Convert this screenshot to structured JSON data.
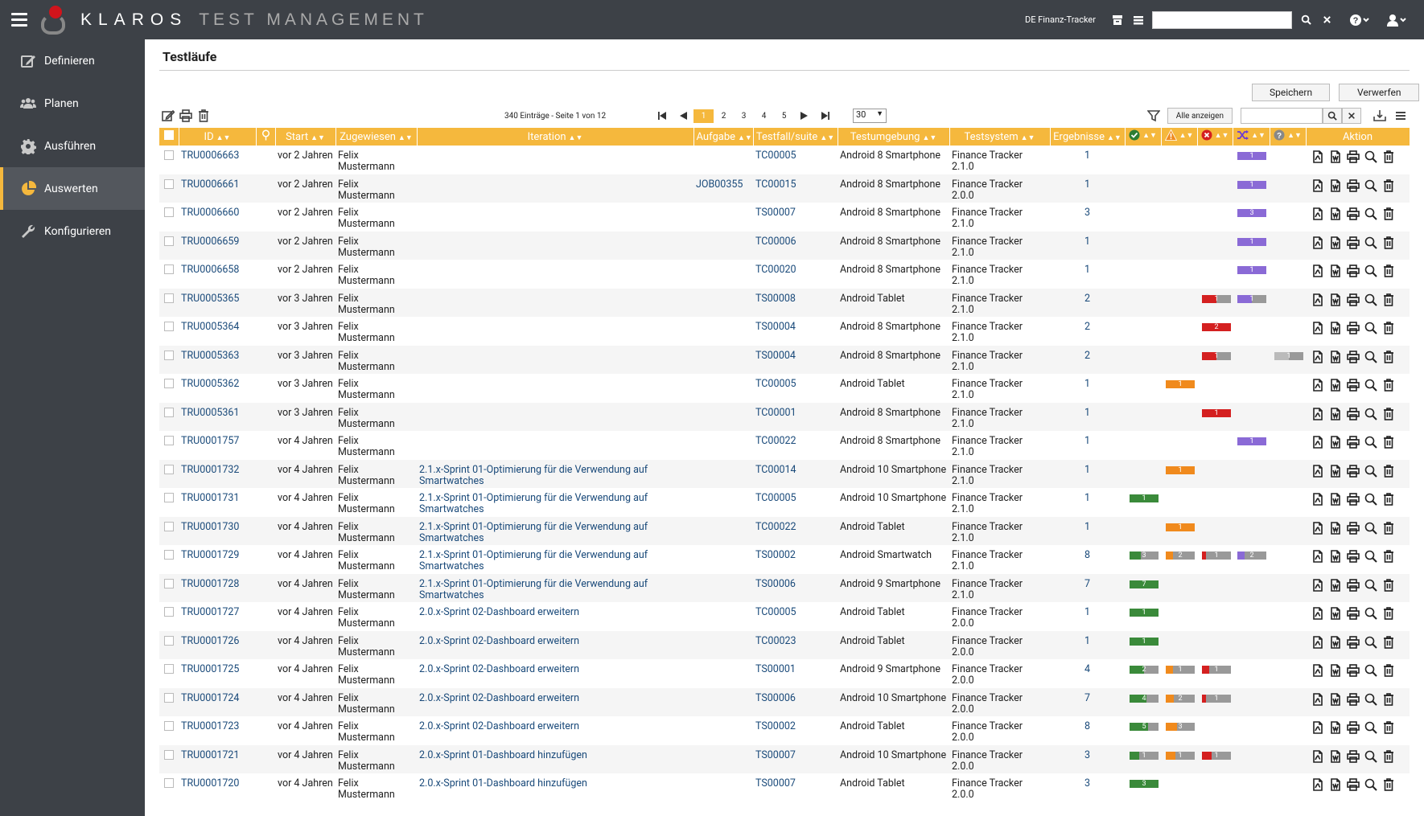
{
  "app": {
    "brand_main": "KLAROS",
    "brand_sub": "TEST MANAGEMENT",
    "project": "DE Finanz-Tracker"
  },
  "sidebar": {
    "items": [
      {
        "label": "Definieren",
        "icon": "edit-icon",
        "active": false
      },
      {
        "label": "Planen",
        "icon": "users-icon",
        "active": false
      },
      {
        "label": "Ausführen",
        "icon": "gear-icon",
        "active": false
      },
      {
        "label": "Auswerten",
        "icon": "pie-chart-icon",
        "active": true
      },
      {
        "label": "Konfigurieren",
        "icon": "wrench-icon",
        "active": false
      }
    ]
  },
  "page": {
    "title": "Testläufe",
    "save_label": "Speichern",
    "discard_label": "Verwerfen"
  },
  "pager": {
    "info": "340 Einträge - Seite 1 von 12",
    "pages": [
      "1",
      "2",
      "3",
      "4",
      "5"
    ],
    "current": "1",
    "per_page": "30",
    "show_all_label": "Alle anzeigen"
  },
  "table": {
    "headers": {
      "id": "ID",
      "start": "Start",
      "assigned": "Zugewiesen",
      "iteration": "Iteration",
      "job": "Aufgabe",
      "testcase": "Testfall/suite",
      "env": "Testumgebung",
      "sut": "Testsystem",
      "results": "Ergebnisse",
      "action": "Aktion"
    },
    "rows": [
      {
        "id": "TRU0006663",
        "start": "vor 2 Jahren",
        "assigned": "Felix Mustermann",
        "iteration": "",
        "job": "",
        "tc": "TC00005",
        "env": "Android 8 Smartphone",
        "sut1": "Finance Tracker",
        "sut2": "2.1.0",
        "results": "1",
        "pass": "",
        "warn": "",
        "fail": "",
        "skip": "1",
        "unk": ""
      },
      {
        "id": "TRU0006661",
        "start": "vor 2 Jahren",
        "assigned": "Felix Mustermann",
        "iteration": "",
        "job": "JOB00355",
        "tc": "TC00015",
        "env": "Android 8 Smartphone",
        "sut1": "Finance Tracker",
        "sut2": "2.0.0",
        "results": "1",
        "pass": "",
        "warn": "",
        "fail": "",
        "skip": "1",
        "unk": ""
      },
      {
        "id": "TRU0006660",
        "start": "vor 2 Jahren",
        "assigned": "Felix Mustermann",
        "iteration": "",
        "job": "",
        "tc": "TS00007",
        "env": "Android 8 Smartphone",
        "sut1": "Finance Tracker",
        "sut2": "2.1.0",
        "results": "3",
        "pass": "",
        "warn": "",
        "fail": "",
        "skip": "3",
        "unk": ""
      },
      {
        "id": "TRU0006659",
        "start": "vor 2 Jahren",
        "assigned": "Felix Mustermann",
        "iteration": "",
        "job": "",
        "tc": "TC00006",
        "env": "Android 8 Smartphone",
        "sut1": "Finance Tracker",
        "sut2": "2.1.0",
        "results": "1",
        "pass": "",
        "warn": "",
        "fail": "",
        "skip": "1",
        "unk": ""
      },
      {
        "id": "TRU0006658",
        "start": "vor 2 Jahren",
        "assigned": "Felix Mustermann",
        "iteration": "",
        "job": "",
        "tc": "TC00020",
        "env": "Android 8 Smartphone",
        "sut1": "Finance Tracker",
        "sut2": "2.1.0",
        "results": "1",
        "pass": "",
        "warn": "",
        "fail": "",
        "skip": "1",
        "unk": ""
      },
      {
        "id": "TRU0005365",
        "start": "vor 3 Jahren",
        "assigned": "Felix Mustermann",
        "iteration": "",
        "job": "",
        "tc": "TS00008",
        "env": "Android Tablet",
        "sut1": "Finance Tracker",
        "sut2": "2.1.0",
        "results": "2",
        "pass": "",
        "warn": "",
        "fail": "1",
        "skip": "1",
        "unk": ""
      },
      {
        "id": "TRU0005364",
        "start": "vor 3 Jahren",
        "assigned": "Felix Mustermann",
        "iteration": "",
        "job": "",
        "tc": "TS00004",
        "env": "Android 8 Smartphone",
        "sut1": "Finance Tracker",
        "sut2": "2.1.0",
        "results": "2",
        "pass": "",
        "warn": "",
        "fail": "2",
        "skip": "",
        "unk": ""
      },
      {
        "id": "TRU0005363",
        "start": "vor 3 Jahren",
        "assigned": "Felix Mustermann",
        "iteration": "",
        "job": "",
        "tc": "TS00004",
        "env": "Android 8 Smartphone",
        "sut1": "Finance Tracker",
        "sut2": "2.1.0",
        "results": "2",
        "pass": "",
        "warn": "",
        "fail": "1",
        "skip": "",
        "unk": "1"
      },
      {
        "id": "TRU0005362",
        "start": "vor 3 Jahren",
        "assigned": "Felix Mustermann",
        "iteration": "",
        "job": "",
        "tc": "TC00005",
        "env": "Android Tablet",
        "sut1": "Finance Tracker",
        "sut2": "2.1.0",
        "results": "1",
        "pass": "",
        "warn": "1",
        "fail": "",
        "skip": "",
        "unk": ""
      },
      {
        "id": "TRU0005361",
        "start": "vor 3 Jahren",
        "assigned": "Felix Mustermann",
        "iteration": "",
        "job": "",
        "tc": "TC00001",
        "env": "Android 8 Smartphone",
        "sut1": "Finance Tracker",
        "sut2": "2.1.0",
        "results": "1",
        "pass": "",
        "warn": "",
        "fail": "1",
        "skip": "",
        "unk": ""
      },
      {
        "id": "TRU0001757",
        "start": "vor 4 Jahren",
        "assigned": "Felix Mustermann",
        "iteration": "",
        "job": "",
        "tc": "TC00022",
        "env": "Android 8 Smartphone",
        "sut1": "Finance Tracker",
        "sut2": "2.1.0",
        "results": "1",
        "pass": "",
        "warn": "",
        "fail": "",
        "skip": "1",
        "unk": ""
      },
      {
        "id": "TRU0001732",
        "start": "vor 4 Jahren",
        "assigned": "Felix Mustermann",
        "iteration": "2.1.x-Sprint 01-Optimierung für die Verwendung auf Smartwatches",
        "job": "",
        "tc": "TC00014",
        "env": "Android 10 Smartphone",
        "sut1": "Finance Tracker",
        "sut2": "2.1.0",
        "results": "1",
        "pass": "",
        "warn": "1",
        "fail": "",
        "skip": "",
        "unk": ""
      },
      {
        "id": "TRU0001731",
        "start": "vor 4 Jahren",
        "assigned": "Felix Mustermann",
        "iteration": "2.1.x-Sprint 01-Optimierung für die Verwendung auf Smartwatches",
        "job": "",
        "tc": "TC00005",
        "env": "Android 10 Smartphone",
        "sut1": "Finance Tracker",
        "sut2": "2.1.0",
        "results": "1",
        "pass": "1",
        "warn": "",
        "fail": "",
        "skip": "",
        "unk": ""
      },
      {
        "id": "TRU0001730",
        "start": "vor 4 Jahren",
        "assigned": "Felix Mustermann",
        "iteration": "2.1.x-Sprint 01-Optimierung für die Verwendung auf Smartwatches",
        "job": "",
        "tc": "TC00022",
        "env": "Android Tablet",
        "sut1": "Finance Tracker",
        "sut2": "2.1.0",
        "results": "1",
        "pass": "",
        "warn": "1",
        "fail": "",
        "skip": "",
        "unk": ""
      },
      {
        "id": "TRU0001729",
        "start": "vor 4 Jahren",
        "assigned": "Felix Mustermann",
        "iteration": "2.1.x-Sprint 01-Optimierung für die Verwendung auf Smartwatches",
        "job": "",
        "tc": "TS00002",
        "env": "Android Smartwatch",
        "sut1": "Finance Tracker",
        "sut2": "2.1.0",
        "results": "8",
        "pass": "3",
        "warn": "2",
        "fail": "1",
        "skip": "2",
        "unk": ""
      },
      {
        "id": "TRU0001728",
        "start": "vor 4 Jahren",
        "assigned": "Felix Mustermann",
        "iteration": "2.1.x-Sprint 01-Optimierung für die Verwendung auf Smartwatches",
        "job": "",
        "tc": "TS00006",
        "env": "Android 9 Smartphone",
        "sut1": "Finance Tracker",
        "sut2": "2.1.0",
        "results": "7",
        "pass": "7",
        "warn": "",
        "fail": "",
        "skip": "",
        "unk": ""
      },
      {
        "id": "TRU0001727",
        "start": "vor 4 Jahren",
        "assigned": "Felix Mustermann",
        "iteration": "2.0.x-Sprint 02-Dashboard erweitern",
        "job": "",
        "tc": "TC00005",
        "env": "Android Tablet",
        "sut1": "Finance Tracker",
        "sut2": "2.0.0",
        "results": "1",
        "pass": "1",
        "warn": "",
        "fail": "",
        "skip": "",
        "unk": ""
      },
      {
        "id": "TRU0001726",
        "start": "vor 4 Jahren",
        "assigned": "Felix Mustermann",
        "iteration": "2.0.x-Sprint 02-Dashboard erweitern",
        "job": "",
        "tc": "TC00023",
        "env": "Android Tablet",
        "sut1": "Finance Tracker",
        "sut2": "2.0.0",
        "results": "1",
        "pass": "1",
        "warn": "",
        "fail": "",
        "skip": "",
        "unk": ""
      },
      {
        "id": "TRU0001725",
        "start": "vor 4 Jahren",
        "assigned": "Felix Mustermann",
        "iteration": "2.0.x-Sprint 02-Dashboard erweitern",
        "job": "",
        "tc": "TS00001",
        "env": "Android 9 Smartphone",
        "sut1": "Finance Tracker",
        "sut2": "2.0.0",
        "results": "4",
        "pass": "2",
        "warn": "1",
        "fail": "1",
        "skip": "",
        "unk": ""
      },
      {
        "id": "TRU0001724",
        "start": "vor 4 Jahren",
        "assigned": "Felix Mustermann",
        "iteration": "2.0.x-Sprint 02-Dashboard erweitern",
        "job": "",
        "tc": "TS00006",
        "env": "Android 10 Smartphone",
        "sut1": "Finance Tracker",
        "sut2": "2.0.0",
        "results": "7",
        "pass": "4",
        "warn": "2",
        "fail": "1",
        "skip": "",
        "unk": ""
      },
      {
        "id": "TRU0001723",
        "start": "vor 4 Jahren",
        "assigned": "Felix Mustermann",
        "iteration": "2.0.x-Sprint 02-Dashboard erweitern",
        "job": "",
        "tc": "TS00002",
        "env": "Android Tablet",
        "sut1": "Finance Tracker",
        "sut2": "2.0.0",
        "results": "8",
        "pass": "5",
        "warn": "3",
        "fail": "",
        "skip": "",
        "unk": ""
      },
      {
        "id": "TRU0001721",
        "start": "vor 4 Jahren",
        "assigned": "Felix Mustermann",
        "iteration": "2.0.x-Sprint 01-Dashboard hinzufügen",
        "job": "",
        "tc": "TS00007",
        "env": "Android 10 Smartphone",
        "sut1": "Finance Tracker",
        "sut2": "2.0.0",
        "results": "3",
        "pass": "1",
        "warn": "1",
        "fail": "1",
        "skip": "",
        "unk": ""
      },
      {
        "id": "TRU0001720",
        "start": "vor 4 Jahren",
        "assigned": "Felix Mustermann",
        "iteration": "2.0.x-Sprint 01-Dashboard hinzufügen",
        "job": "",
        "tc": "TS00007",
        "env": "Android Tablet",
        "sut1": "Finance Tracker",
        "sut2": "2.0.0",
        "results": "3",
        "pass": "3",
        "warn": "",
        "fail": "",
        "skip": "",
        "unk": ""
      }
    ]
  },
  "colors": {
    "accent": "#f5b83d",
    "sidebar_bg": "#3d4147",
    "pass": "#3a8a3a",
    "warn": "#f08a1d",
    "fail": "#d42020",
    "skip": "#8a6ad6",
    "unknown": "#bbbbbb"
  }
}
